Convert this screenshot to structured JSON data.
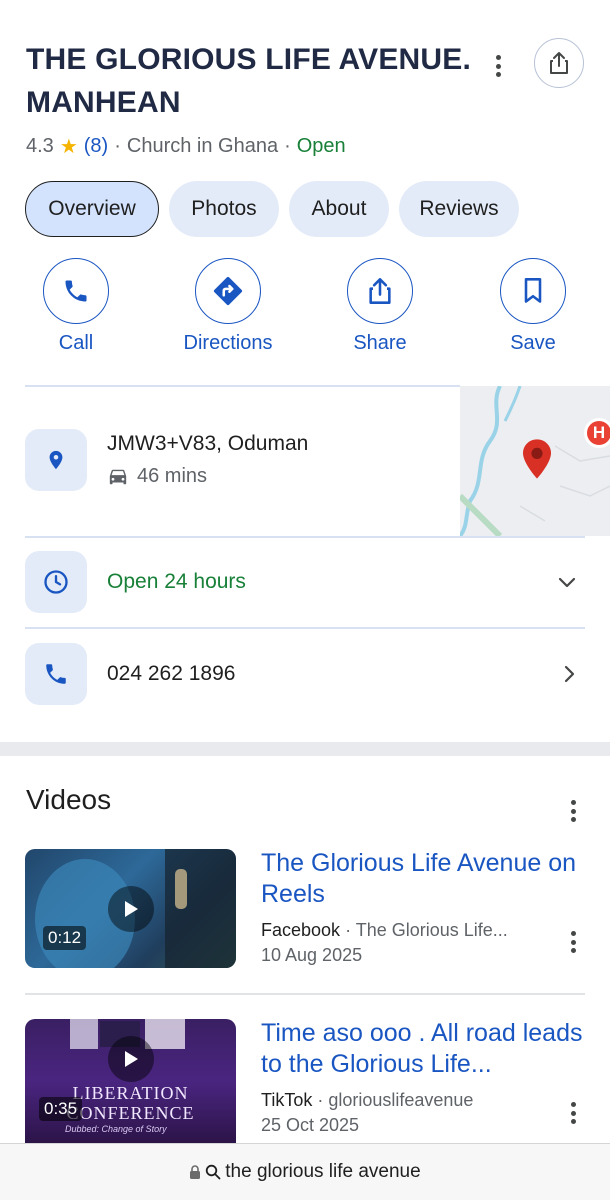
{
  "place": {
    "title": "THE GLORIOUS LIFE AVENUE. MANHEAN",
    "rating": "4.3",
    "review_count": "(8)",
    "category": "Church in Ghana",
    "status": "Open",
    "separator": "·"
  },
  "tabs": [
    {
      "label": "Overview",
      "active": true
    },
    {
      "label": "Photos",
      "active": false
    },
    {
      "label": "About",
      "active": false
    },
    {
      "label": "Reviews",
      "active": false
    }
  ],
  "actions": [
    {
      "label": "Call",
      "icon": "phone-icon"
    },
    {
      "label": "Directions",
      "icon": "directions-icon"
    },
    {
      "label": "Share",
      "icon": "share-icon"
    },
    {
      "label": "Save",
      "icon": "bookmark-icon"
    }
  ],
  "location": {
    "address": "JMW3+V83, Oduman",
    "drive_time": "46 mins",
    "map_badge": "H"
  },
  "hours": {
    "text": "Open 24 hours"
  },
  "phone": {
    "number": "024 262 1896"
  },
  "videos": {
    "heading": "Videos",
    "items": [
      {
        "title": "The Glorious Life Avenue on Reels",
        "source": "Facebook",
        "channel": "The Glorious Life...",
        "date": "10 Aug 2025",
        "duration": "0:12"
      },
      {
        "title": "Time aso ooo . All road leads to the Glorious Life...",
        "source": "TikTok",
        "channel": "gloriouslifeavenue",
        "date": "25 Oct 2025",
        "duration": "0:35",
        "thumb_text_1": "LIBERATION",
        "thumb_text_2": "CONFERENCE",
        "thumb_text_3": "Dubbed: Change of Story"
      }
    ]
  },
  "browser": {
    "url_text": "the glorious life avenue"
  },
  "colors": {
    "accent": "#1a56c2",
    "open": "#188038",
    "chip": "#e4ebf8",
    "star": "#f4b400",
    "pin": "#d93025"
  }
}
